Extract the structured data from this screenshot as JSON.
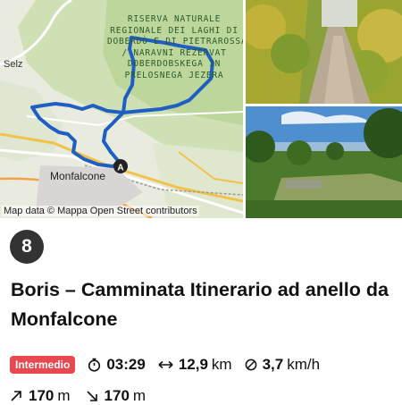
{
  "map": {
    "credit": "Map data © Mappa Open Street contributors",
    "reserve_label_lines": [
      "RISERVA NATURALE",
      "REGIONALE DEI LAGHI DI",
      "DOBERDÒ E DI PIETRAROSSA",
      "/ NARAVNI REZERVAT",
      "DOBERDOBSKEGA IN",
      "PRELOSNEGA JEZERA"
    ],
    "town_labels": [
      "Selz",
      "Monfalcone"
    ],
    "start_marker": "A",
    "route_color": "#1f5fc4"
  },
  "photos": [
    {
      "name": "forest-path-photo"
    },
    {
      "name": "meadow-view-photo"
    }
  ],
  "route": {
    "number": "8",
    "title": "Boris – Camminata Itinerario ad anello da Monfalcone",
    "level": "Intermedio",
    "level_color": "#e8484f",
    "duration": "03:29",
    "distance_value": "12,9",
    "distance_unit": "km",
    "speed_value": "3,7",
    "speed_unit": "km/h",
    "ascent_value": "170",
    "ascent_unit": "m",
    "descent_value": "170",
    "descent_unit": "m"
  }
}
